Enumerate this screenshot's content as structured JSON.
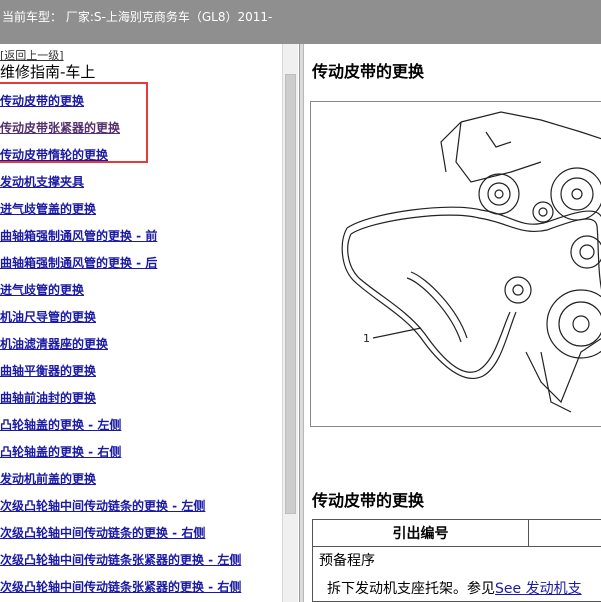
{
  "header": {
    "vehicle_label": "当前车型：",
    "vehicle_value": "厂家:S-上海别克商务车（GL8）2011-"
  },
  "nav": {
    "back_label": "[返回上一级]",
    "title": "维修指南-车上",
    "links": [
      "传动皮带的更换",
      "传动皮带张紧器的更换",
      "传动皮带惰轮的更换",
      "发动机支撑夹具",
      "进气歧管盖的更换",
      "曲轴箱强制通风管的更换 - 前",
      "曲轴箱强制通风管的更换 - 后",
      "进气歧管的更换",
      "机油尺导管的更换",
      "机油滤清器座的更换",
      "曲轴平衡器的更换",
      "曲轴前油封的更换",
      "凸轮轴盖的更换 - 左侧",
      "凸轮轴盖的更换 - 右侧",
      "发动机前盖的更换",
      "次级凸轮轴中间传动链条的更换 - 左侧",
      "次级凸轮轴中间传动链条的更换 - 右侧",
      "次级凸轮轴中间传动链条张紧器的更换 - 左侧",
      "次级凸轮轴中间传动链条张紧器的更换 - 右侧"
    ]
  },
  "content": {
    "title": "传动皮带的更换",
    "figure_callout": "1",
    "section2_title": "传动皮带的更换",
    "table_header": "引出编号",
    "prep_label": "预备程序",
    "step_text": "拆下发动机支座托架。参见",
    "step_link": "See 发动机支"
  },
  "colors": {
    "header_bg": "#8f8f8f",
    "link": "#1a1aa6",
    "highlight_border": "#e23b3b"
  }
}
